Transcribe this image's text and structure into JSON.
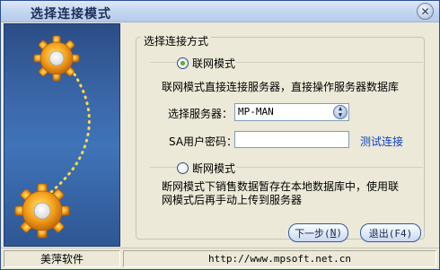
{
  "window": {
    "title": "选择连接模式",
    "close_icon": "close-icon"
  },
  "group": {
    "legend": "选择连接方式"
  },
  "online": {
    "label": "联网模式",
    "selected": true,
    "description": "联网模式直接连接服务器，直接操作服务器数据库",
    "server_label": "选择服务器：",
    "server_value": "MP-MAN",
    "password_label": "SA用户密码：",
    "password_value": "",
    "test_link": "测试连接"
  },
  "offline": {
    "label": "断网模式",
    "selected": false,
    "description_line1": "断网模式下销售数据暂存在本地数据库中，使用联",
    "description_line2": "网模式后再手动上传到服务器"
  },
  "buttons": {
    "next_prefix": "下一步(",
    "next_key": "N",
    "next_suffix": ")",
    "exit": "退出(F4)"
  },
  "status": {
    "company": "美萍软件",
    "url": "http://www.mpsoft.net.cn"
  },
  "colors": {
    "side_panel": "#3b68aa",
    "link": "#0b3fbd",
    "radio_selected": "#2f8f21"
  }
}
